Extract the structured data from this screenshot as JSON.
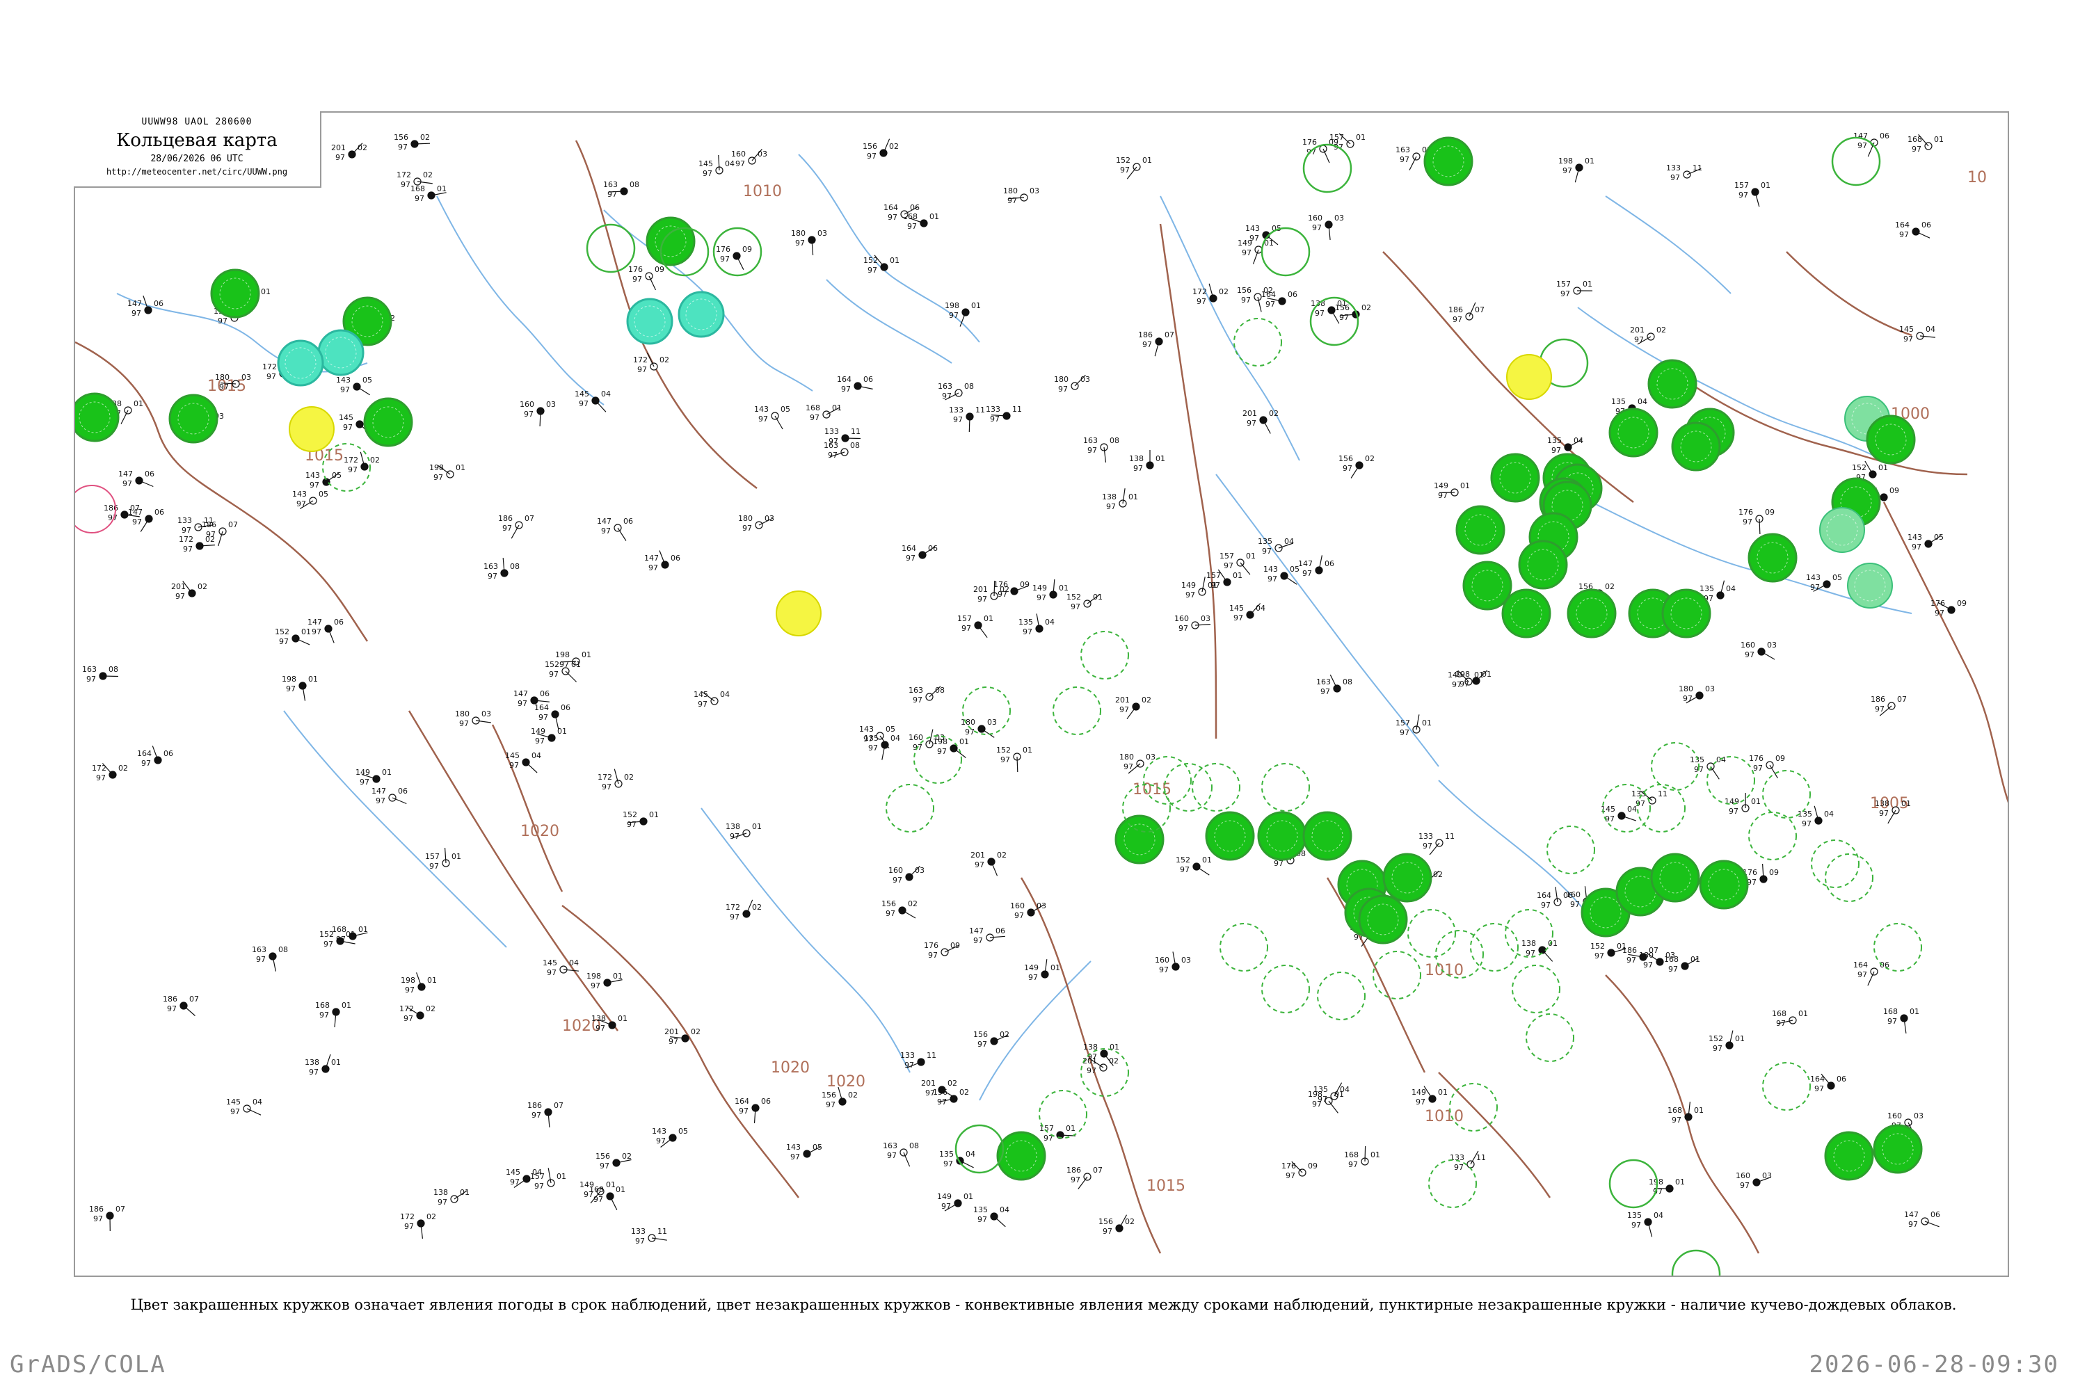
{
  "header": {
    "bulletin": "UUWW98  UAOL  280600",
    "title": "Кольцевая карта",
    "datetime": "28/06/2026 06 UTC",
    "url": "http://meteocenter.net/circ/UUWW.png"
  },
  "legend_note": "Цвет закрашенных кружков означает явления погоды в срок наблюдений, цвет незакрашенных кружков - конвективные явления между сроками наблюдений, пунктирные незакрашенные кружки - наличие кучево-дождевых облаков.",
  "footer": {
    "software": "GrADS/COLA",
    "timestamp": "2026-06-28-09:30"
  },
  "isobar_labels": [
    "1010",
    "1015",
    "1015",
    "1020",
    "1020",
    "1020",
    "1020",
    "1015",
    "1010",
    "1005",
    "1000",
    "1015",
    "1010",
    "10",
    "10"
  ],
  "colors": {
    "isobar": "#a0624d",
    "river": "#7fb6e6",
    "precip": "#19c219",
    "thunder_green": "#2db82d",
    "shower": "#4de3c0",
    "fog_yellow": "#f5f542",
    "mist_light": "#f7f7a0",
    "light_green": "#7fe0a0",
    "dashed_cb": "#3cb43c",
    "pink": "#e05080"
  },
  "stations": [
    {
      "t": "152",
      "d": "97",
      "p": "01"
    },
    {
      "t": "163",
      "d": "97",
      "p": "08"
    },
    {
      "t": "149",
      "d": "97",
      "p": "01"
    },
    {
      "t": "160",
      "d": "97",
      "p": "03"
    },
    {
      "t": "156",
      "d": "97",
      "p": "02"
    },
    {
      "t": "168",
      "d": "97",
      "p": "01"
    },
    {
      "t": "147",
      "d": "97",
      "p": "06"
    },
    {
      "t": "135",
      "d": "97",
      "p": "04"
    },
    {
      "t": "172",
      "d": "97",
      "p": "02"
    },
    {
      "t": "138",
      "d": "97",
      "p": "01"
    },
    {
      "t": "180",
      "d": "97",
      "p": "03"
    },
    {
      "t": "186",
      "d": "97",
      "p": "07"
    },
    {
      "t": "157",
      "d": "97",
      "p": "01"
    },
    {
      "t": "143",
      "d": "97",
      "p": "05"
    },
    {
      "t": "201",
      "d": "97",
      "p": "02"
    },
    {
      "t": "176",
      "d": "97",
      "p": "09"
    },
    {
      "t": "133",
      "d": "97",
      "p": "11"
    },
    {
      "t": "145",
      "d": "97",
      "p": "04"
    },
    {
      "t": "198",
      "d": "97",
      "p": "01"
    },
    {
      "t": "164",
      "d": "97",
      "p": "06"
    }
  ]
}
